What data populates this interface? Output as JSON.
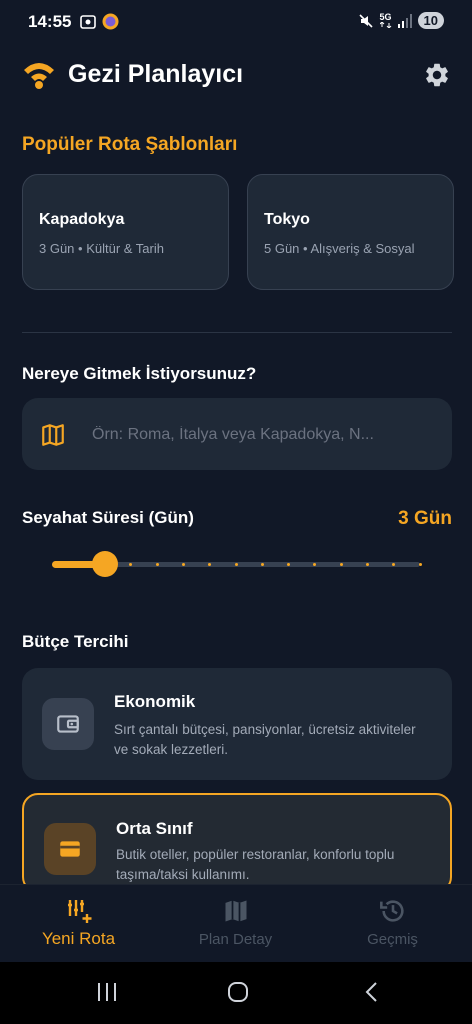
{
  "status_bar": {
    "time": "14:55",
    "network": "5G",
    "battery": "10"
  },
  "header": {
    "title": "Gezi Planlayıcı"
  },
  "templates": {
    "section_title": "Popüler Rota Şablonları",
    "items": [
      {
        "name": "Kapadokya",
        "meta": "3 Gün • Kültür & Tarih"
      },
      {
        "name": "Tokyo",
        "meta": "5 Gün • Alışveriş & Sosyal"
      }
    ]
  },
  "destination": {
    "label": "Nereye Gitmek İstiyorsunuz?",
    "placeholder": "Örn: Roma, İtalya veya Kapadokya, N...",
    "value": ""
  },
  "duration": {
    "label": "Seyahat Süresi (Gün)",
    "value_text": "3 Gün",
    "slider": {
      "min": 1,
      "max": 15,
      "value": 3
    }
  },
  "budget": {
    "label": "Bütçe Tercihi",
    "options": [
      {
        "title": "Ekonomik",
        "desc": "Sırt çantalı bütçesi, pansiyonlar, ücretsiz aktiviteler ve sokak lezzetleri.",
        "selected": false
      },
      {
        "title": "Orta Sınıf",
        "desc": "Butik oteller, popüler restoranlar, konforlu toplu taşıma/taksi kullanımı.",
        "selected": true
      }
    ]
  },
  "bottom_nav": {
    "items": [
      {
        "label": "Yeni Rota",
        "icon": "add-route-icon",
        "active": true
      },
      {
        "label": "Plan Detay",
        "icon": "map-icon",
        "active": false
      },
      {
        "label": "Geçmiş",
        "icon": "history-icon",
        "active": false
      }
    ]
  },
  "colors": {
    "accent": "#f5a623",
    "background": "#111827",
    "card": "#1f2937",
    "muted": "#9aa3b2"
  }
}
